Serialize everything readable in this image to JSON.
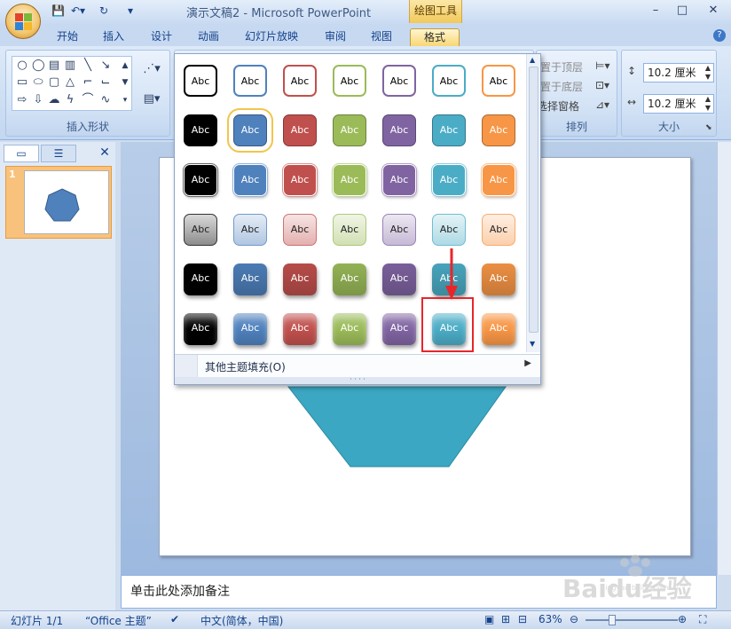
{
  "window": {
    "doc_title": "演示文稿2 - Microsoft PowerPoint",
    "context_tool": "绘图工具",
    "minimize": "–",
    "maximize": "□",
    "close": "✕"
  },
  "quick_access": {
    "save": "save-icon",
    "undo": "undo-icon",
    "redo": "redo-icon",
    "customize": "▾"
  },
  "tabs": [
    {
      "label": "开始",
      "active": false
    },
    {
      "label": "插入",
      "active": false
    },
    {
      "label": "设计",
      "active": false
    },
    {
      "label": "动画",
      "active": false
    },
    {
      "label": "幻灯片放映",
      "active": false
    },
    {
      "label": "审阅",
      "active": false
    },
    {
      "label": "视图",
      "active": false
    },
    {
      "label": "格式",
      "active": true
    }
  ],
  "help": "?",
  "ribbon": {
    "insert_shapes_label": "插入形状",
    "arrange_label": "排列",
    "size_label": "大小",
    "bring_front": "置于顶层",
    "send_back": "置于底层",
    "selection_pane": "选择窗格",
    "height_value": "10.2 厘米",
    "width_value": "10.2 厘米"
  },
  "gallery": {
    "cell_text": "Abc",
    "colors": [
      "#000000",
      "#4f81bd",
      "#c0504d",
      "#9bbb59",
      "#8064a2",
      "#4bacc6",
      "#f79646"
    ],
    "row_styles": [
      "outline",
      "fill",
      "fill-light-border",
      "pastel",
      "intense",
      "glossy"
    ],
    "selected_row": 6,
    "selected_col": 6,
    "hover_row": 2,
    "hover_col": 2,
    "more_fills": "其他主题填充(O)"
  },
  "slides_panel": {
    "slide_number": "1"
  },
  "notes_placeholder": "单击此处添加备注",
  "status": {
    "slide": "幻灯片 1/1",
    "theme": "“Office 主题”",
    "language": "中文(简体，中国)",
    "zoom": "63%"
  },
  "watermark_text": "Baidu经验",
  "watermark_sub": "jingyan.baidu.com"
}
